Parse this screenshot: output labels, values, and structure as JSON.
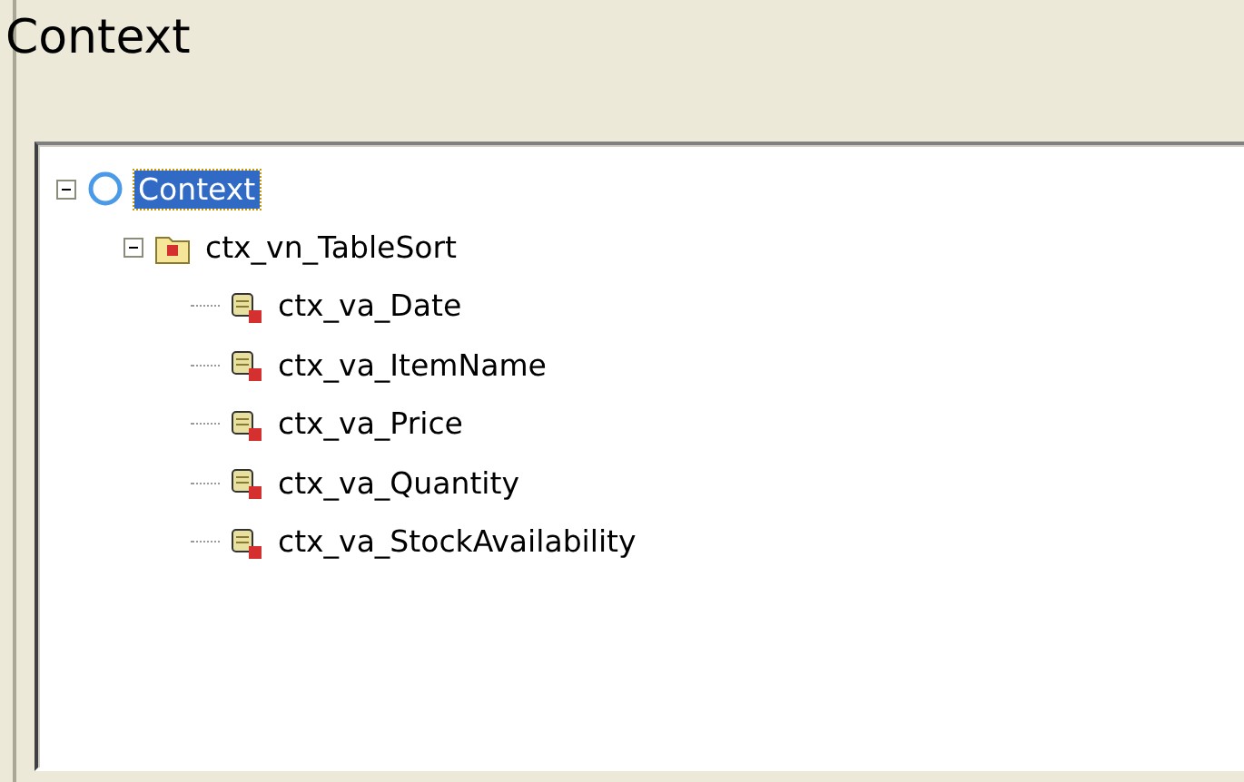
{
  "panel": {
    "title": "Context"
  },
  "tree": [
    {
      "label": "Context",
      "kind": "context",
      "selected": true,
      "expanded": true,
      "children": [
        {
          "label": "ctx_vn_TableSort",
          "kind": "node",
          "selected": false,
          "expanded": true,
          "children": [
            {
              "label": "ctx_va_Date",
              "kind": "attribute",
              "selected": false
            },
            {
              "label": "ctx_va_ItemName",
              "kind": "attribute",
              "selected": false
            },
            {
              "label": "ctx_va_Price",
              "kind": "attribute",
              "selected": false
            },
            {
              "label": "ctx_va_Quantity",
              "kind": "attribute",
              "selected": false
            },
            {
              "label": "ctx_va_StockAvailability",
              "kind": "attribute",
              "selected": false
            }
          ]
        }
      ]
    }
  ]
}
